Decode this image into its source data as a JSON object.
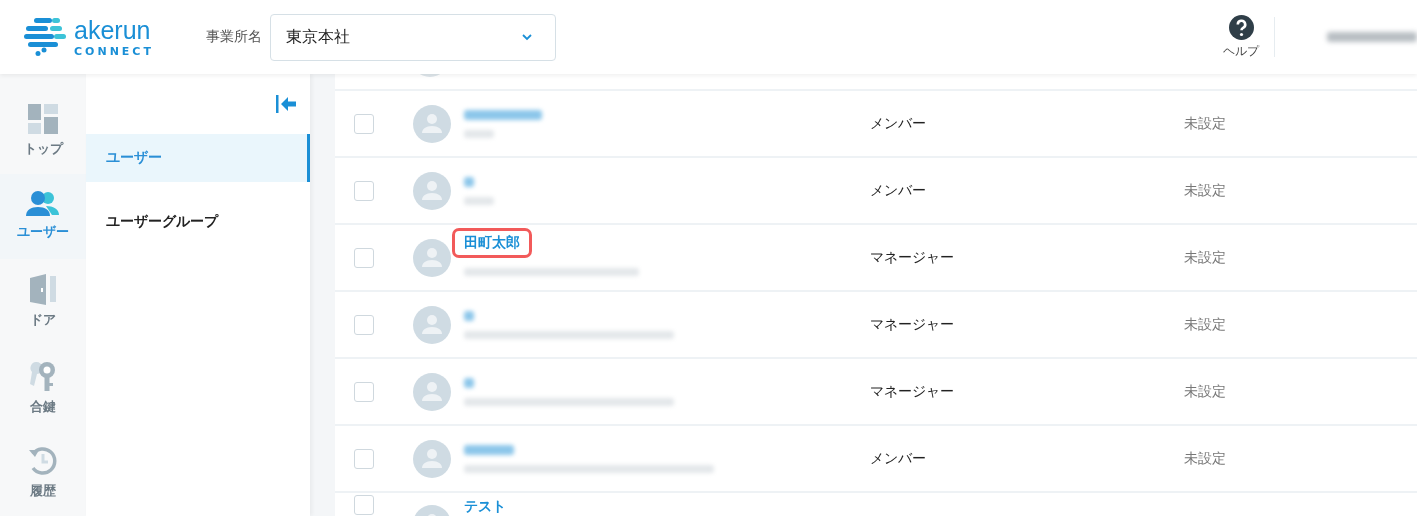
{
  "header": {
    "logo": {
      "wordmark": "akerun",
      "tagline": "CONNECT"
    },
    "office_label": "事業所名",
    "office_select": {
      "value": "東京本社"
    },
    "help": {
      "label": "ヘルプ"
    },
    "account": {
      "redacted": true
    }
  },
  "rail": [
    {
      "kind": "top",
      "label": "トップ",
      "selected": false
    },
    {
      "kind": "users",
      "label": "ユーザー",
      "selected": true
    },
    {
      "kind": "door",
      "label": "ドア",
      "selected": false
    },
    {
      "kind": "key",
      "label": "合鍵",
      "selected": false
    },
    {
      "kind": "history",
      "label": "履歴",
      "selected": false
    }
  ],
  "subnav": {
    "items": [
      {
        "label": "ユーザー",
        "selected": true
      },
      {
        "label": "ユーザーグループ",
        "selected": false
      }
    ]
  },
  "rows": [
    {
      "redacted": true,
      "checked": false,
      "role": "メンバー",
      "status": "未設定"
    },
    {
      "redacted": true,
      "checked": false,
      "role": "メンバー",
      "status": "未設定"
    },
    {
      "redacted": false,
      "name": "田町太郎",
      "highlighted": true,
      "checked": false,
      "role": "マネージャー",
      "status": "未設定"
    },
    {
      "redacted": true,
      "checked": false,
      "role": "マネージャー",
      "status": "未設定"
    },
    {
      "redacted": true,
      "checked": false,
      "role": "マネージャー",
      "status": "未設定"
    },
    {
      "redacted": true,
      "checked": false,
      "role": "メンバー",
      "status": "未設定"
    },
    {
      "redacted": false,
      "name": "テスト",
      "highlighted": false,
      "checked": false
    }
  ]
}
